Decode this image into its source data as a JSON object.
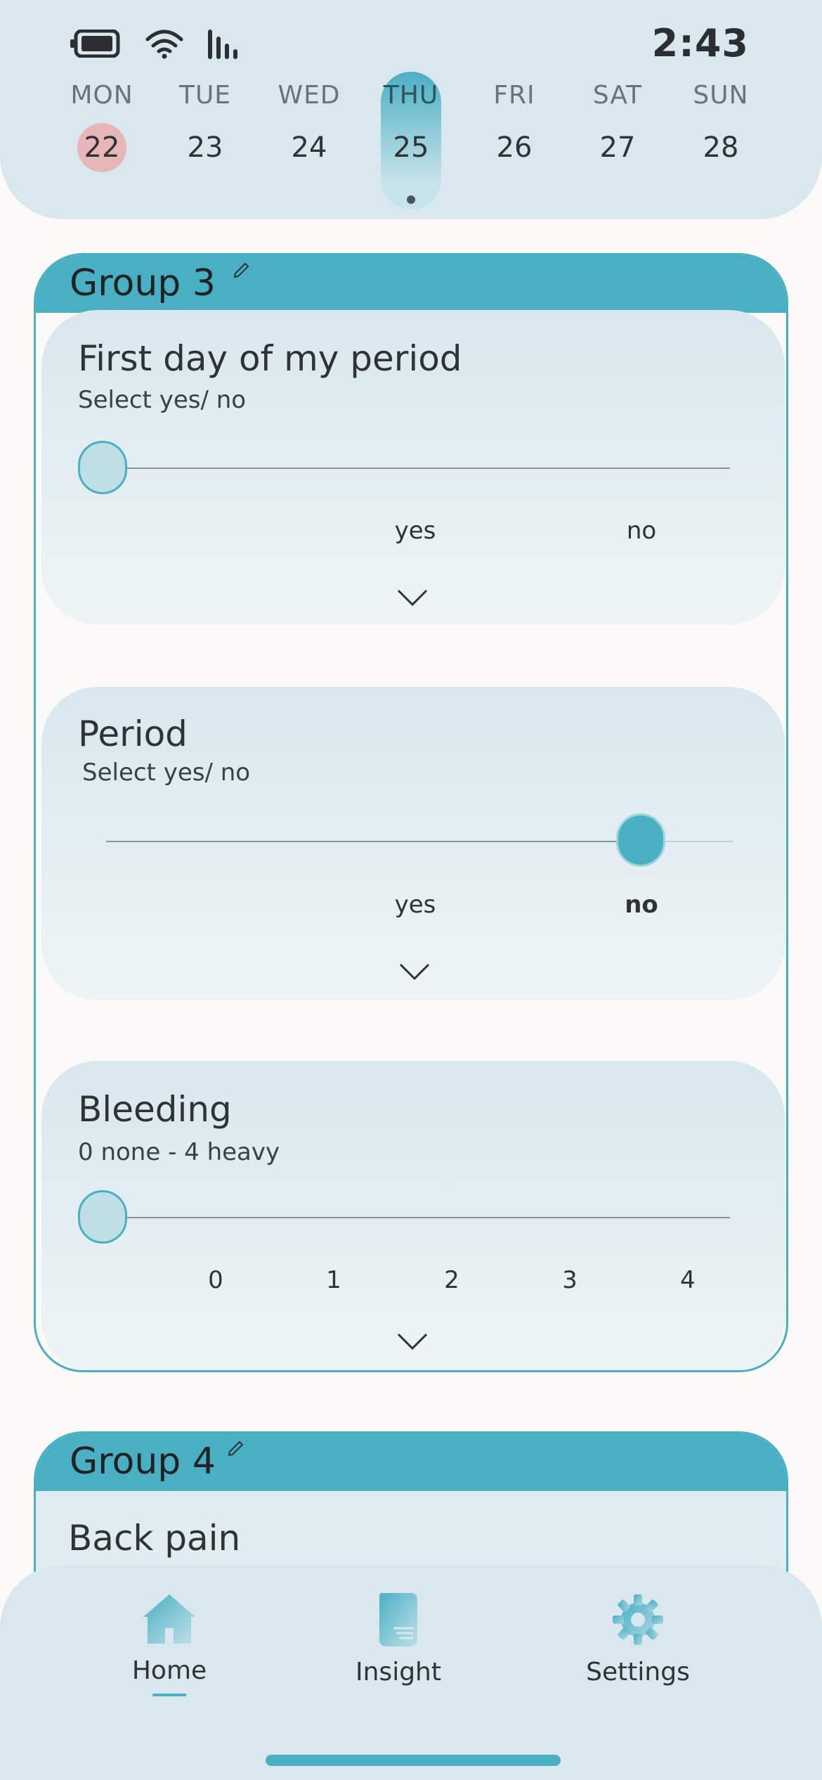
{
  "status_bar": {
    "time": "2:43",
    "icons": [
      "battery-icon",
      "wifi-icon",
      "signal-icon"
    ]
  },
  "week": {
    "days": [
      {
        "name": "MON",
        "date": "22",
        "state": "period"
      },
      {
        "name": "TUE",
        "date": "23",
        "state": "normal"
      },
      {
        "name": "WED",
        "date": "24",
        "state": "normal"
      },
      {
        "name": "THU",
        "date": "25",
        "state": "selected"
      },
      {
        "name": "FRI",
        "date": "26",
        "state": "normal"
      },
      {
        "name": "SAT",
        "date": "27",
        "state": "normal"
      },
      {
        "name": "SUN",
        "date": "28",
        "state": "normal"
      }
    ]
  },
  "groups": [
    {
      "title": "Group 3",
      "cards": [
        {
          "title": "First day of my period",
          "subtitle": "Select yes/ no",
          "options": [
            "yes",
            "no"
          ],
          "selected": null
        },
        {
          "title": "Period",
          "subtitle": "Select yes/ no",
          "options": [
            "yes",
            "no"
          ],
          "selected": "no"
        },
        {
          "title": "Bleeding",
          "subtitle": "0 none - 4 heavy",
          "options": [
            "0",
            "1",
            "2",
            "3",
            "4"
          ],
          "selected": null
        }
      ]
    },
    {
      "title": "Group 4",
      "cards": [
        {
          "title": "Back pain"
        }
      ]
    }
  ],
  "nav": {
    "items": [
      {
        "label": "Home",
        "icon": "home-icon",
        "active": true
      },
      {
        "label": "Insight",
        "icon": "insight-icon",
        "active": false
      },
      {
        "label": "Settings",
        "icon": "gear-icon",
        "active": false
      }
    ]
  },
  "colors": {
    "accent": "#49b0c3",
    "header_bg": "#d8e8ee",
    "period_marker": "#e7b6b7",
    "page_bg": "#fbfaf7"
  }
}
